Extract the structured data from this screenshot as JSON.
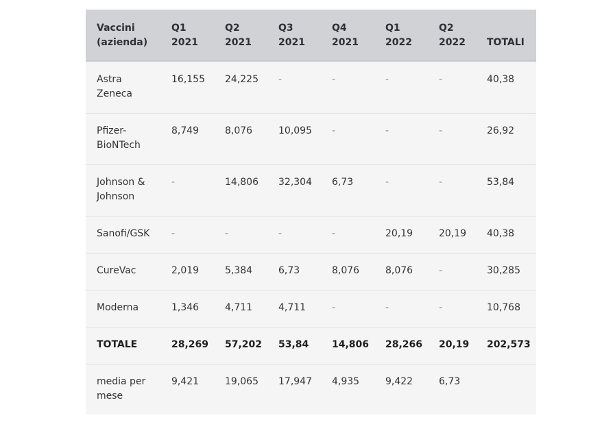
{
  "table": {
    "columns": [
      {
        "line1": "Vaccini",
        "line2": "(azienda)"
      },
      {
        "line1": "Q1",
        "line2": "2021"
      },
      {
        "line1": "Q2",
        "line2": "2021"
      },
      {
        "line1": "Q3",
        "line2": "2021"
      },
      {
        "line1": "Q4",
        "line2": "2021"
      },
      {
        "line1": "Q1",
        "line2": "2022"
      },
      {
        "line1": "Q2",
        "line2": "2022"
      },
      {
        "line1": "TOTALI",
        "line2": ""
      }
    ],
    "rows": [
      {
        "label1": "Astra",
        "label2": "Zeneca",
        "values": [
          "16,155",
          "24,225",
          "-",
          "-",
          "-",
          "-",
          "40,38"
        ]
      },
      {
        "label1": "Pfizer-",
        "label2": "BioNTech",
        "values": [
          "8,749",
          "8,076",
          "10,095",
          "-",
          "-",
          "-",
          "26,92"
        ]
      },
      {
        "label1": "Johnson &",
        "label2": "Johnson",
        "values": [
          "-",
          "14,806",
          "32,304",
          "6,73",
          "-",
          "-",
          "53,84"
        ]
      },
      {
        "label1": "Sanofi/GSK",
        "label2": "",
        "values": [
          "-",
          "-",
          "-",
          "-",
          "20,19",
          "20,19",
          "40,38"
        ]
      },
      {
        "label1": "CureVac",
        "label2": "",
        "values": [
          "2,019",
          "5,384",
          "6,73",
          "8,076",
          "8,076",
          "-",
          "30,285"
        ]
      },
      {
        "label1": "Moderna",
        "label2": "",
        "values": [
          "1,346",
          "4,711",
          "4,711",
          "-",
          "-",
          "-",
          "10,768"
        ]
      },
      {
        "label1": "TOTALE",
        "label2": "",
        "bold": true,
        "values": [
          "28,269",
          "57,202",
          "53,84",
          "14,806",
          "28,266",
          "20,19",
          "202,573"
        ]
      },
      {
        "label1": "media per",
        "label2": "mese",
        "values": [
          "9,421",
          "19,065",
          "17,947",
          "4,935",
          "9,422",
          "6,73",
          ""
        ]
      }
    ]
  }
}
